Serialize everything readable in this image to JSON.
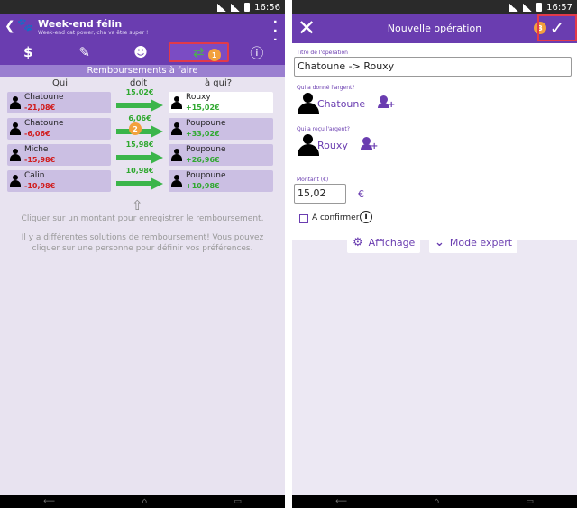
{
  "status_left": {
    "time": "16:56"
  },
  "status_right": {
    "time": "16:57"
  },
  "left": {
    "appbar": {
      "title": "Week-end félin",
      "subtitle": "Week-end cat power, cha va être super !",
      "back_icon": "back-arrow-icon",
      "paw_icon": "paw-icon",
      "more_icon": "more-vert-icon"
    },
    "tabs": [
      {
        "icon": "dollar-icon",
        "glyph": "$"
      },
      {
        "icon": "receipt-icon",
        "glyph": "🧾"
      },
      {
        "icon": "person-icon",
        "glyph": "👤"
      },
      {
        "icon": "refresh-icon",
        "glyph": "⇆",
        "active": true,
        "badge": "1"
      },
      {
        "icon": "info-icon",
        "glyph": "ⓘ"
      }
    ],
    "section_title": "Remboursements à faire",
    "columns": {
      "who": "Qui",
      "owes": "doit",
      "to_whom": "à qui?"
    },
    "rows": [
      {
        "debtor": "Chatoune",
        "debtor_balance": "-21,08€",
        "amount": "15,02€",
        "creditor": "Rouxy",
        "creditor_balance": "+15,02€",
        "badge": ""
      },
      {
        "debtor": "Chatoune",
        "debtor_balance": "-6,06€",
        "amount": "6,06€",
        "creditor": "Poupoune",
        "creditor_balance": "+33,02€",
        "badge": "2"
      },
      {
        "debtor": "Miche",
        "debtor_balance": "-15,98€",
        "amount": "15,98€",
        "creditor": "Poupoune",
        "creditor_balance": "+26,96€",
        "badge": ""
      },
      {
        "debtor": "Calin",
        "debtor_balance": "-10,98€",
        "amount": "10,98€",
        "creditor": "Poupoune",
        "creditor_balance": "+10,98€",
        "badge": ""
      }
    ],
    "hint1": "Cliquer sur un montant pour enregistrer le remboursement.",
    "hint2": "Il y a différentes solutions de remboursement! Vous pouvez cliquer sur une personne pour définir vos préférences."
  },
  "right": {
    "title": "Nouvelle opération",
    "badge": "3",
    "title_label": "Titre de l'opération",
    "title_value": "Chatoune -> Rouxy",
    "giver_label": "Qui a donné l'argent?",
    "giver": "Chatoune",
    "receiver_label": "Qui a reçu l'argent?",
    "receiver": "Rouxy",
    "amount_label": "Montant (€)",
    "amount_value": "15,02",
    "currency": "€",
    "confirm_label": "A confirmer",
    "display_button": "Affichage",
    "expert_button": "Mode expert"
  },
  "colors": {
    "primary": "#6a3db0",
    "accent": "#f2a03d",
    "highlight": "#e23a4a",
    "positive": "#2fa82f",
    "negative": "#d11c1c"
  }
}
